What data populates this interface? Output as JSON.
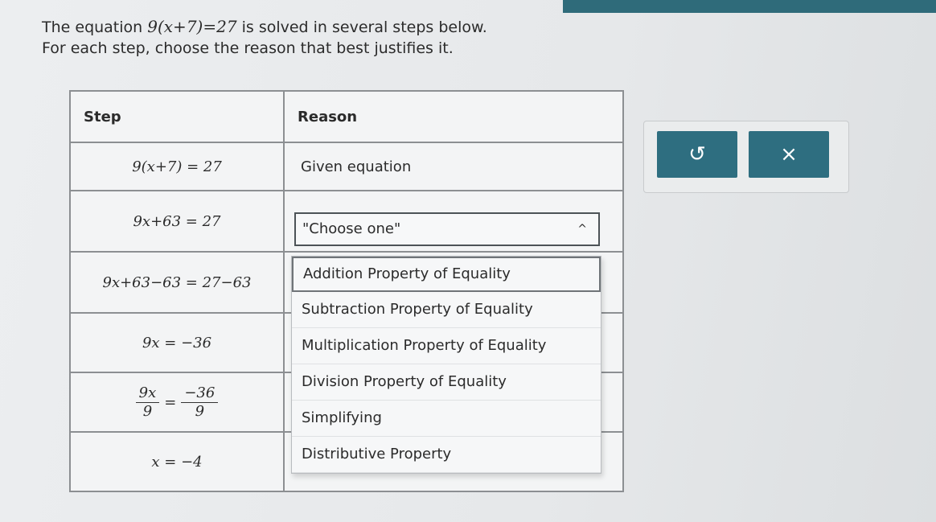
{
  "intro": {
    "line1_pre": "The equation ",
    "equation": "9(x+7)=27",
    "line1_post": " is solved in several steps below.",
    "line2": "For each step, choose the reason that best justifies it."
  },
  "table": {
    "header_step": "Step",
    "header_reason": "Reason",
    "rows": [
      {
        "step": "9(x+7) = 27",
        "reason": "Given equation"
      },
      {
        "step": "9x+63 = 27",
        "reason": ""
      },
      {
        "step": "9x+63−63 = 27−63",
        "reason": ""
      },
      {
        "step": "9x = −36",
        "reason": ""
      },
      {
        "step_num": "9x",
        "step_den": "9",
        "step_rnum": "−36",
        "step_rden": "9",
        "reason": ""
      },
      {
        "step": "x = −4",
        "reason": ""
      }
    ]
  },
  "select": {
    "value": "\"Choose one\"",
    "chevron": "^"
  },
  "dropdown": {
    "options": [
      "Addition Property of Equality",
      "Subtraction Property of Equality",
      "Multiplication Property of Equality",
      "Division Property of Equality",
      "Simplifying",
      "Distributive Property"
    ]
  },
  "buttons": {
    "undo_glyph": "↺",
    "clear_glyph": "×"
  },
  "colors": {
    "accent": "#2e6e80",
    "topbar": "#2f6b7a"
  }
}
